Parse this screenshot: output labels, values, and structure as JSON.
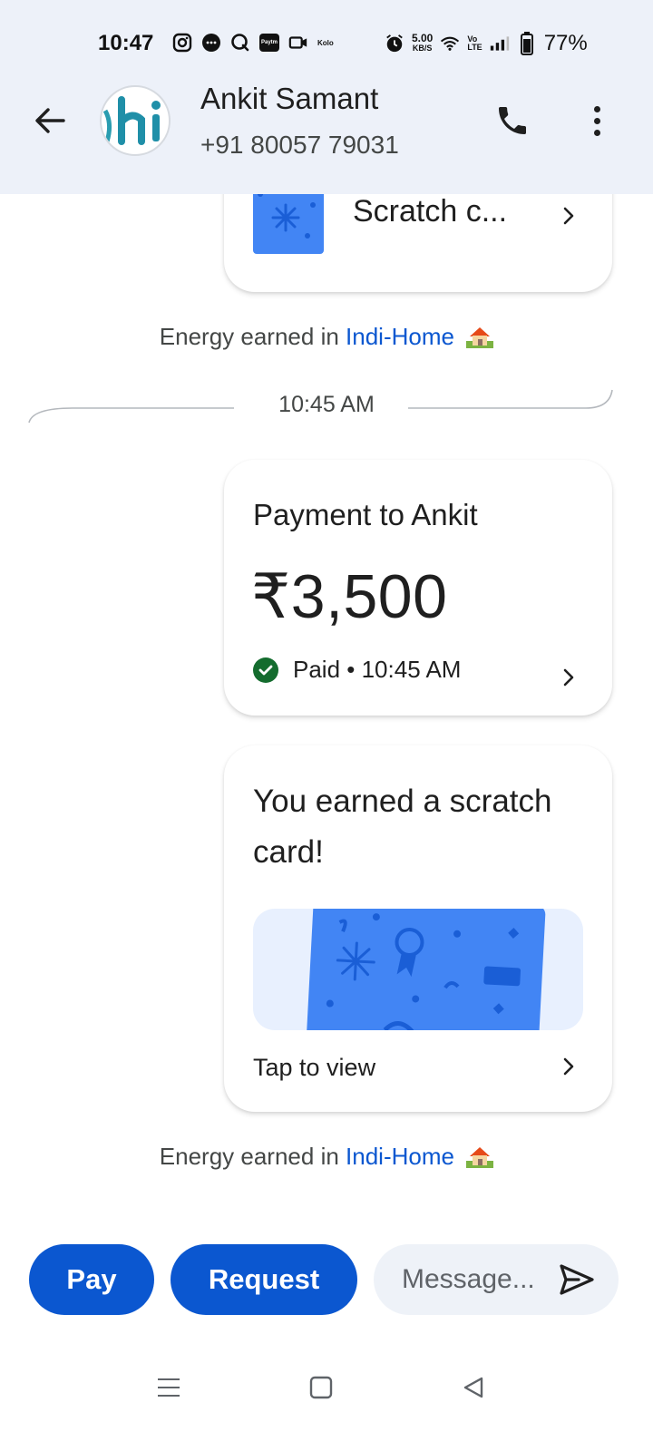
{
  "status_bar": {
    "time": "10:47",
    "net_speed_value": "5.00",
    "net_speed_unit": "KB/S",
    "volte_top": "Vo",
    "volte_bottom": "LTE",
    "battery_percent": "77%",
    "left_icons": [
      "instagram-icon",
      "messenger-icon",
      "q-app-icon",
      "paytm-icon",
      "camera-icon",
      "kolo-icon"
    ],
    "paytm_label": "Paytm",
    "kolo_label": "Kolo"
  },
  "header": {
    "contact_name": "Ankit Samant",
    "contact_phone": "+91 80057 79031",
    "avatar_text": "hi"
  },
  "messages": {
    "top_card_label": "Scratch c...",
    "energy_prefix": "Energy earned in ",
    "energy_link": "Indi-Home",
    "time_separator": "10:45 AM",
    "payment": {
      "title": "Payment to Ankit",
      "amount": "₹3,500",
      "status": "Paid • 10:45 AM"
    },
    "scratch": {
      "title": "You earned a scratch card!",
      "action": "Tap to view"
    }
  },
  "composer": {
    "pay_label": "Pay",
    "request_label": "Request",
    "message_placeholder": "Message..."
  },
  "colors": {
    "header_bg": "#edf1f9",
    "primary_blue": "#0b57d0",
    "link_blue": "#0b57d0",
    "paid_green": "#146c2e",
    "scratch_blue": "#4285f4"
  }
}
